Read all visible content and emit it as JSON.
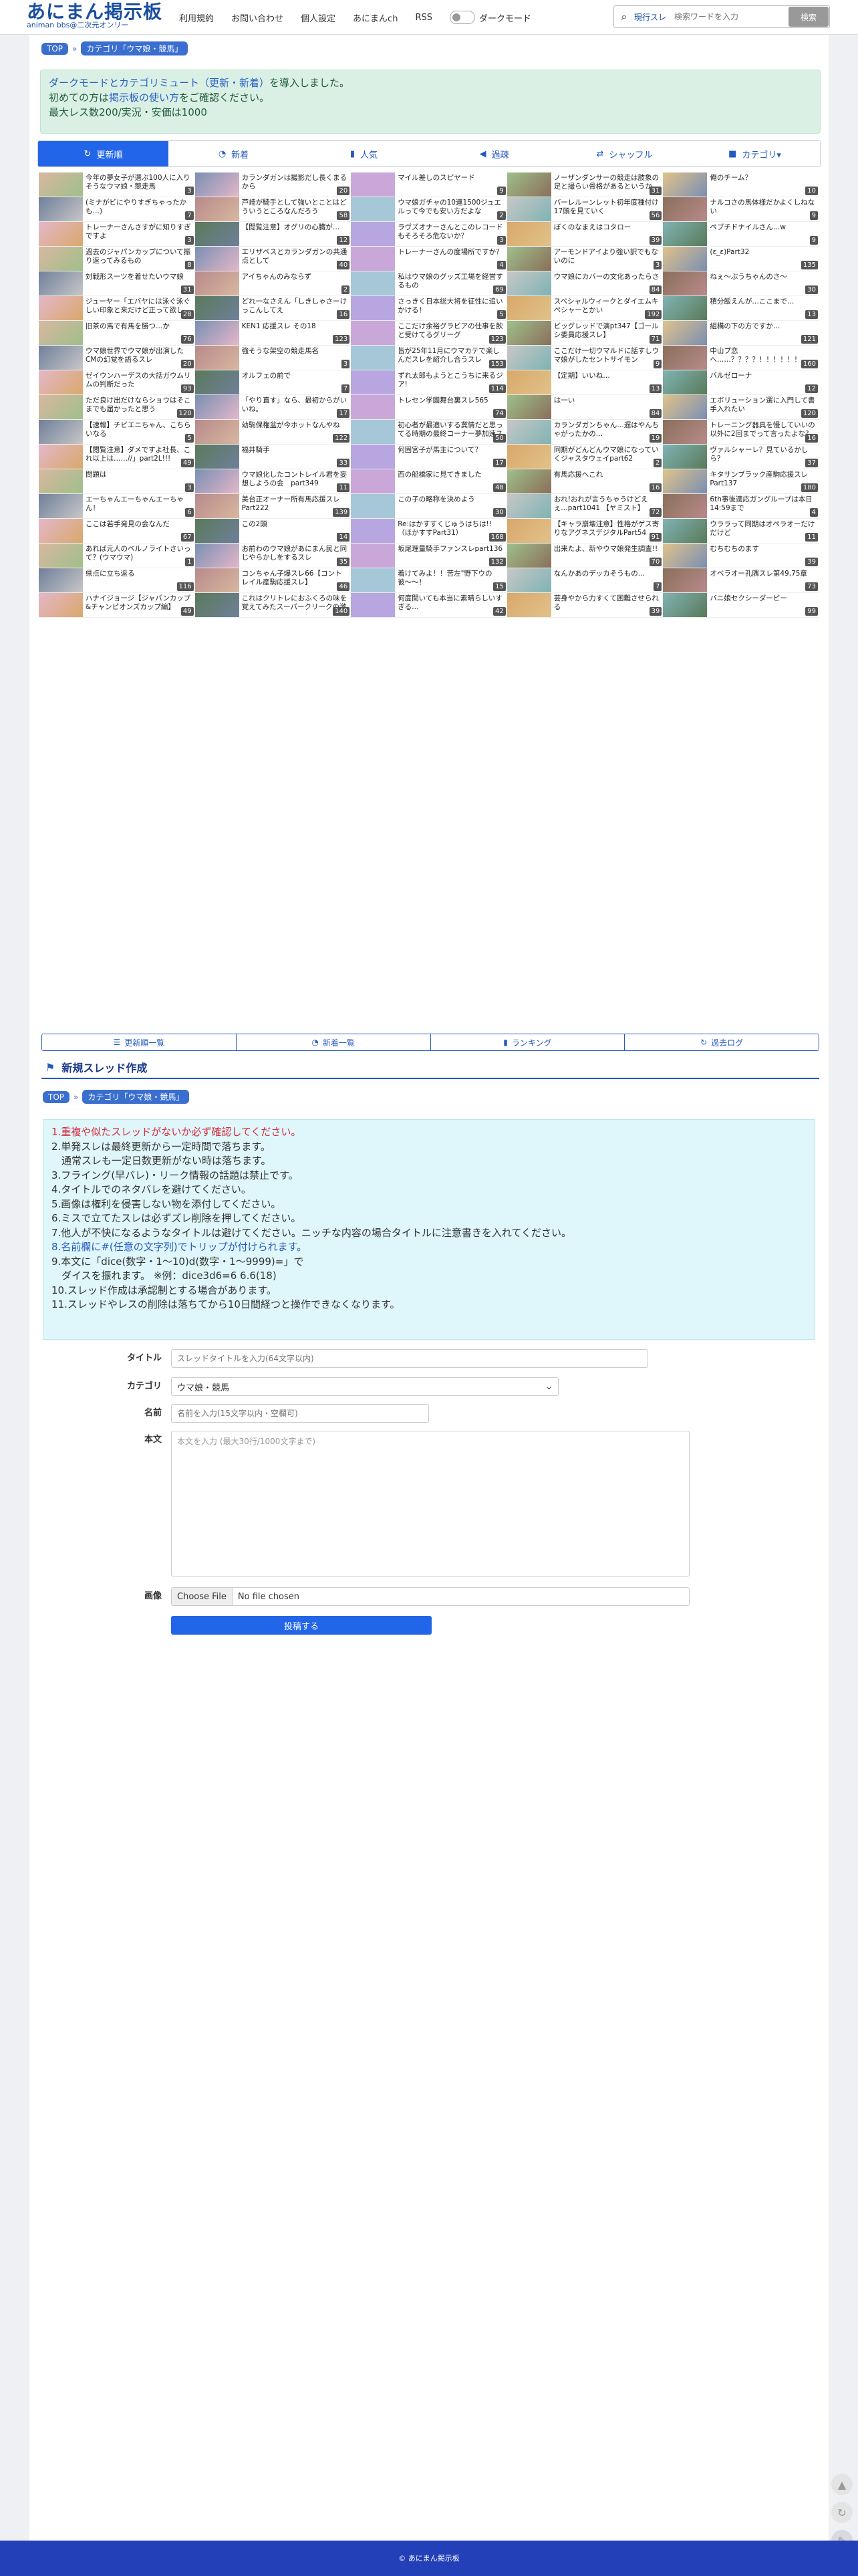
{
  "header": {
    "logo_main": "あにまん掲示板",
    "logo_sub": "animan bbs@二次元オンリー",
    "nav": [
      "利用規約",
      "お問い合わせ",
      "個人設定",
      "あにまんch",
      "RSS"
    ],
    "dark_mode_label": "ダークモード",
    "search_scope": "現行スレ",
    "search_placeholder": "検索ワードを入力",
    "search_button": "検索"
  },
  "breadcrumb": {
    "top": "TOP",
    "sep": "»",
    "category": "カテゴリ「ウマ娘・競馬」"
  },
  "notice": {
    "line1_link": "ダークモードとカテゴリミュート（更新・新着）",
    "line1_rest": "を導入しました。",
    "line2_pre": "初めての方は",
    "line2_link": "掲示板の使い方",
    "line2_post": "をご確認ください。",
    "line3": "最大レス数200/実況・安価は1000"
  },
  "tabs": [
    {
      "icon": "↻",
      "label": "更新順",
      "active": true
    },
    {
      "icon": "◔",
      "label": "新着",
      "active": false
    },
    {
      "icon": "▮",
      "label": "人気",
      "active": false
    },
    {
      "icon": "◀",
      "label": "過疎",
      "active": false
    },
    {
      "icon": "⇄",
      "label": "シャッフル",
      "active": false
    },
    {
      "icon": "■",
      "label": "カテゴリ▾",
      "active": false
    }
  ],
  "threads": [
    {
      "title": "今年の夢女子が選ぶ100人に入りそうなウマ娘・競走馬",
      "count": "3"
    },
    {
      "title": "カランダガンは撮影だし長くまるから",
      "count": "20"
    },
    {
      "title": "マイル差しのスピヤード",
      "count": "9"
    },
    {
      "title": "ノーザンダンサーの競走は肢象の足と撮らい骨格があるというか",
      "count": "31"
    },
    {
      "title": "俺のチーム？",
      "count": "10"
    },
    {
      "title": "(ミナがビにやりすぎちゃったかも…)",
      "count": "7"
    },
    {
      "title": "芦崎が騎手として強いとことはどういうところなんだろう",
      "count": "58"
    },
    {
      "title": "ウマ娘ガチャの10連1500ジュエルって今でも安い方だよな",
      "count": "2"
    },
    {
      "title": "バーレルーンレット初年度種付け17頭を見ていく",
      "count": "56"
    },
    {
      "title": "ナルコさの馬体様だかよくしねない",
      "count": "9"
    },
    {
      "title": "トレーナーさんさすがに知りすぎですよ",
      "count": "3"
    },
    {
      "title": "【閲覧注意】オグリの心臓が…",
      "count": "12"
    },
    {
      "title": "ラヴズオナーさんとこのレコードもそろそろ危ないか？",
      "count": "3"
    },
    {
      "title": "ぼくのなまえはコタロー",
      "count": "39"
    },
    {
      "title": "ペプチドナイルさん…w",
      "count": "9"
    },
    {
      "title": "過去のジャパンカップについて振り返ってみるもの",
      "count": "8"
    },
    {
      "title": "エリザベスとカランダガンの共通点として",
      "count": "40"
    },
    {
      "title": "トレーナーさんの度場所ですか？",
      "count": "4"
    },
    {
      "title": "アーモンドアイより強い訳でもないのに",
      "count": "3"
    },
    {
      "title": "(ε_ε)Part32",
      "count": "135"
    },
    {
      "title": "対戦形スーツを着せたいウマ娘",
      "count": "31"
    },
    {
      "title": "アイちゃんのみならず",
      "count": "2"
    },
    {
      "title": "私はウマ娘のグッズ工場を経営するもの",
      "count": "69"
    },
    {
      "title": "ウマ娘にカバーの文化あったらさ",
      "count": "84"
    },
    {
      "title": "ねぇ～ぶうちゃんのさ～",
      "count": "30"
    },
    {
      "title": "ジューヤー「エバヤには泳ぐ泳ぐしい印象と来だけど正って欲しい」",
      "count": "28"
    },
    {
      "title": "どれ一なさえん「しきしゃさーけっこんしてえ",
      "count": "16"
    },
    {
      "title": "さっきく日本総大将を征性に追いかける！",
      "count": "5"
    },
    {
      "title": "スペシャルウィークとダイエムキペシャーとかい",
      "count": "192"
    },
    {
      "title": "積分飯えんが…ここまで…",
      "count": "13"
    },
    {
      "title": "旧茶の馬で有馬を勝つ…か",
      "count": "76"
    },
    {
      "title": "KEN1 応援スレ その18",
      "count": "123"
    },
    {
      "title": "ここだけ余裕グラビアの仕事を飲と受けてるグリーグ",
      "count": "123"
    },
    {
      "title": "ビッグレッドで演pt347【ゴールシ委員応援スレ】",
      "count": "71"
    },
    {
      "title": "組構の下の方ですか…",
      "count": "121"
    },
    {
      "title": "ウマ娘世界でウマ娘が出演したCMの幻覚を語るスレ",
      "count": "20"
    },
    {
      "title": "強そうな架空の競走馬名",
      "count": "3"
    },
    {
      "title": "皆が25年11月にウマカテで楽しんだスレを紹介し合うスレ",
      "count": "153"
    },
    {
      "title": "ここだけ一切ウマルドに話すしウマ娘がしたセントサイモン",
      "count": "9"
    },
    {
      "title": "中山プ恋へ……？？？？！！！！！！",
      "count": "160"
    },
    {
      "title": "ゼイウンハーデスの大話ガウムリムの判断だった",
      "count": "93"
    },
    {
      "title": "オルフェの前で",
      "count": "7"
    },
    {
      "title": "ずれ太郎もようとこうちに来るジア!",
      "count": "114"
    },
    {
      "title": "【定期】いいね…",
      "count": "13"
    },
    {
      "title": "バルゼローナ",
      "count": "12"
    },
    {
      "title": "ただ良け出だけならショウはそこまでも届かったと思う",
      "count": "120"
    },
    {
      "title": "「やり直す」なら、最初からがいいね。",
      "count": "17"
    },
    {
      "title": "トレセン学園舞台裏スレ565",
      "count": "74"
    },
    {
      "title": "は一い",
      "count": "84"
    },
    {
      "title": "エボリューション選に入門して書手入れたい",
      "count": "120"
    },
    {
      "title": "【速報】チビエニちゃん、こちらいなる",
      "count": "5"
    },
    {
      "title": "幼駒保権盆が今ホットなんやね",
      "count": "122"
    },
    {
      "title": "初心者が最適いする冀情だと思ってる時期の最終コーナー夢加速スキル",
      "count": "50"
    },
    {
      "title": "カランダガンちゃん…遅はやんちゃがったかの…",
      "count": "19"
    },
    {
      "title": "トレーニング器具を慢していいの以外に2回までって言ったよな?",
      "count": "16"
    },
    {
      "title": "【閲覧注意】ダメですよ社長、これ以上は……//」part2L!!!",
      "count": "49"
    },
    {
      "title": "福井騎手",
      "count": "33"
    },
    {
      "title": "何固宮子が馬主について？",
      "count": "17"
    },
    {
      "title": "同期がどんどんウマ娘になっていくジャスタウェイpart62",
      "count": "2"
    },
    {
      "title": "ヴァルシャーレ？見ているかしら？",
      "count": "37"
    },
    {
      "title": "問題は",
      "count": "3"
    },
    {
      "title": "ウマ娘化したコントレイル君を妄想しようの会　part349",
      "count": "11"
    },
    {
      "title": "西の船橋家に見てきました",
      "count": "48"
    },
    {
      "title": "有馬応援へこれ",
      "count": "16"
    },
    {
      "title": "キタサンブラック産駒応援スレ Part137",
      "count": "180"
    },
    {
      "title": "エーちゃんエーちゃんエーちゃん！",
      "count": "6"
    },
    {
      "title": "美台正オーナー所有馬応援スレ Part222",
      "count": "139"
    },
    {
      "title": "この子の略称を決めよう",
      "count": "30"
    },
    {
      "title": "おれ!おれが言うちゃうけどえぇ…part1041 【ヤミスト】",
      "count": "72"
    },
    {
      "title": "6th事後適応ガングループは本日14:59まで",
      "count": "4"
    },
    {
      "title": "ここは若手発見の会なんだ",
      "count": "67"
    },
    {
      "title": "この2頭",
      "count": "14"
    },
    {
      "title": "Re:はかすすくじゅうはちは!!（ほかすすPart31）",
      "count": "168"
    },
    {
      "title": "【キャラ崩壊注意】性格がゲス寄りなアグネスデジタルPart54",
      "count": "91"
    },
    {
      "title": "ウララって同期はオペラオーだけだけど",
      "count": "11"
    },
    {
      "title": "あれば元人のベルノライトさいって？(ウマウマ)",
      "count": "1"
    },
    {
      "title": "お前わのウマ娘があにまん民と同じやらかしをするスレ",
      "count": "35"
    },
    {
      "title": "坂尾理量騎手ファンスレpart136",
      "count": "132"
    },
    {
      "title": "出来たよ、新やウマ娘発生調査!!",
      "count": "70"
    },
    {
      "title": "むちむちのます",
      "count": "39"
    },
    {
      "title": "県点に立ち返る",
      "count": "116"
    },
    {
      "title": "コンちゃん子爆スレ66【コントレイル産駒応援スレ】",
      "count": "46"
    },
    {
      "title": "着けてみよ！！苦左\"野下ウの彼〜〜！",
      "count": "15"
    },
    {
      "title": "なんかあのデッカそうもの…",
      "count": "7"
    },
    {
      "title": "オペラオー孔隅スレ第49,75章",
      "count": "73"
    },
    {
      "title": "ハナイジョージ【ジャパンカップ&チャンピオンズカップ編】",
      "count": "49"
    },
    {
      "title": "これはクリトレにおふくろの味を覚えてみたスーパークリークの激",
      "count": "140"
    },
    {
      "title": "何度聞いても本当に素晴らしいすぎる…",
      "count": "42"
    },
    {
      "title": "芸身やから力すくて困難させられる",
      "count": "39"
    },
    {
      "title": "バニ娘セクシーダービー",
      "count": "99"
    }
  ],
  "bottom_buttons": [
    {
      "icon": "☰",
      "label": "更新順一覧"
    },
    {
      "icon": "◔",
      "label": "新着一覧"
    },
    {
      "icon": "▮",
      "label": "ランキング"
    },
    {
      "icon": "↻",
      "label": "過去ログ"
    }
  ],
  "new_thread": {
    "title": "新規スレッド作成",
    "rules": [
      {
        "text": "1.重複や似たスレッドがないか必ず確認してください。",
        "style": "red"
      },
      {
        "text": "2.単発スレは最終更新から一定時間で落ちます。",
        "style": ""
      },
      {
        "text": "　通常スレも一定日数更新がない時は落ちます。",
        "style": ""
      },
      {
        "text": "3.フライング(早バレ)・リーク情報の話題は禁止です。",
        "style": ""
      },
      {
        "text": "4.タイトルでのネタバレを避けてください。",
        "style": ""
      },
      {
        "text": "5.画像は権利を侵害しない物を添付してください。",
        "style": ""
      },
      {
        "text": "6.ミスで立てたスレは必ずズレ削除を押してください。",
        "style": ""
      },
      {
        "text": "7.他人が不快になるようなタイトルは避けてください。ニッチな内容の場合タイトルに注意書きを入れてください。",
        "style": ""
      },
      {
        "text": "8.名前欄に#(任意の文字列)でトリップが付けられます。",
        "style": "blue"
      },
      {
        "text": "9.本文に「dice(数字・1〜10)d(数字・1〜9999)=」で",
        "style": ""
      },
      {
        "text": "　ダイスを振れます。 ※例：dice3d6=6 6.6(18)",
        "style": ""
      },
      {
        "text": "10.スレッド作成は承認制とする場合があります。",
        "style": ""
      },
      {
        "text": "11.スレッドやレスの削除は落ちてから10日間経つと操作できなくなります。",
        "style": ""
      }
    ],
    "labels": {
      "title": "タイトル",
      "category": "カテゴリ",
      "name": "名前",
      "body": "本文",
      "image": "画像"
    },
    "placeholders": {
      "title": "スレッドタイトルを入力(64文字以内)",
      "name": "名前を入力(15文字以内・空欄可)",
      "body": "本文を入力 (最大30行/1000文字まで)"
    },
    "category_value": "ウマ娘・競馬",
    "file_button": "Choose File",
    "file_status": "No file chosen",
    "submit": "投稿する"
  },
  "footer": "© あにまん掲示板",
  "colors": {
    "accent": "#2365e8",
    "brand": "#1a4fa0",
    "notice_bg": "#dbf0e4",
    "rules_bg": "#dff6fa",
    "footer": "#2340b8"
  }
}
